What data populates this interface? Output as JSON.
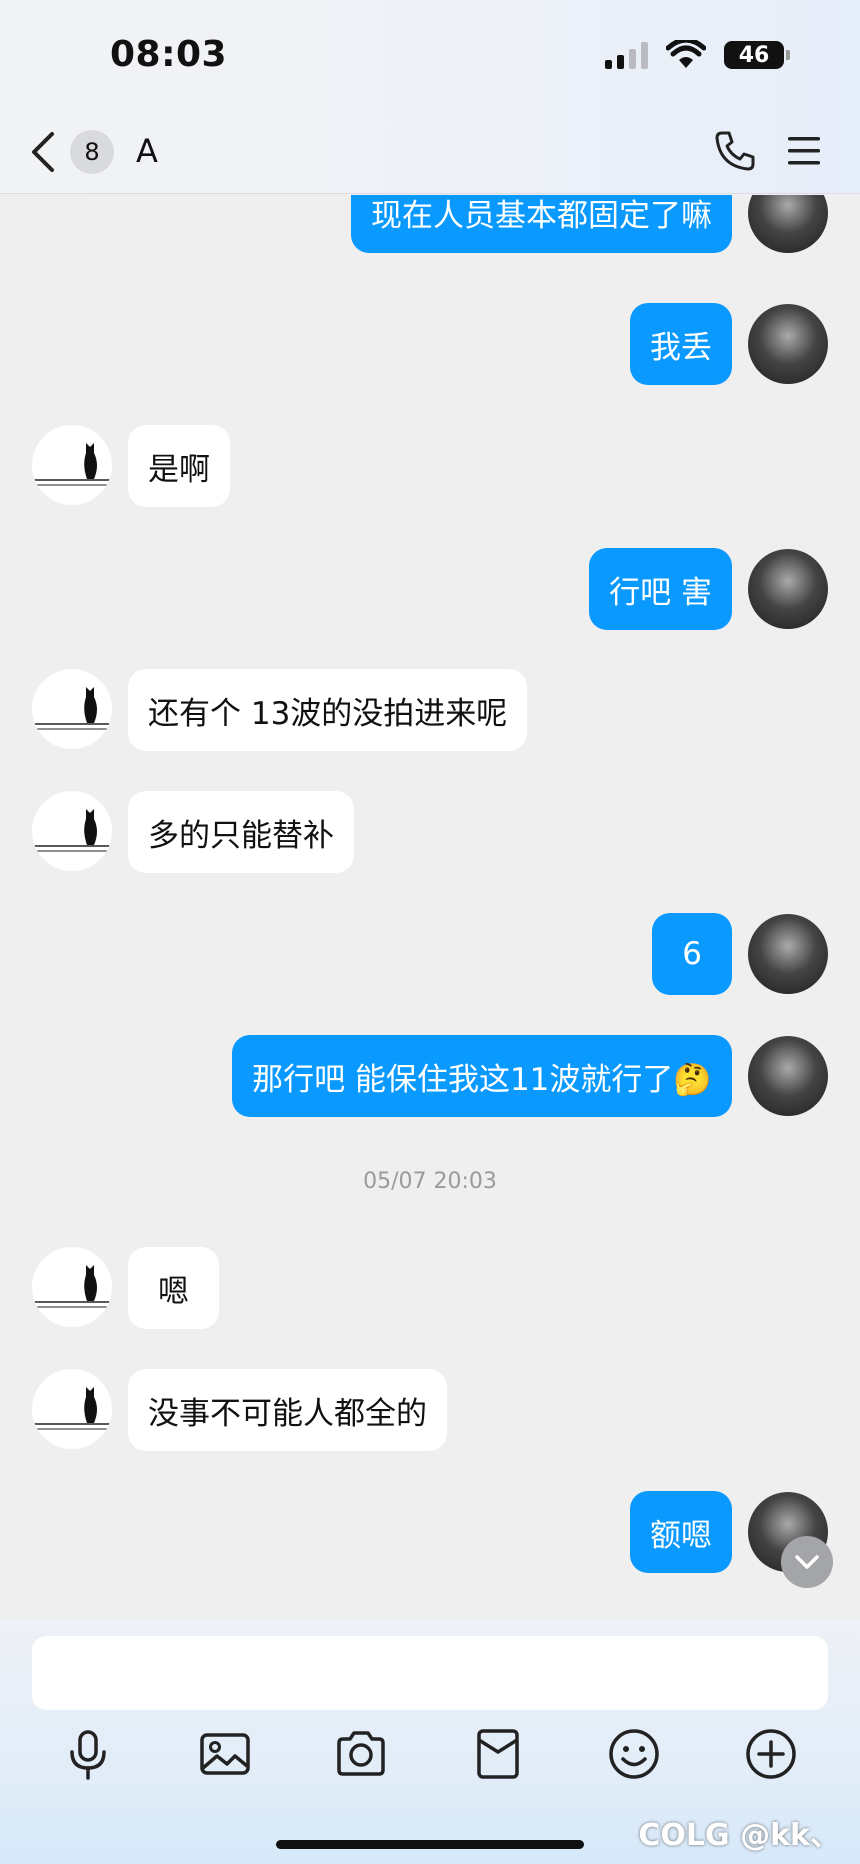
{
  "status_bar": {
    "time": "08:03",
    "battery": "46"
  },
  "header": {
    "unread_count": "8",
    "title": "A"
  },
  "messages": [
    {
      "from": "me",
      "text": "现在人员基本都固定了嘛"
    },
    {
      "from": "me",
      "text": "我丢"
    },
    {
      "from": "other",
      "text": "是啊"
    },
    {
      "from": "me",
      "text": "行吧 害"
    },
    {
      "from": "other",
      "text": "还有个 13波的没拍进来呢"
    },
    {
      "from": "other",
      "text": "多的只能替补"
    },
    {
      "from": "me",
      "text": "6"
    },
    {
      "from": "me",
      "text": "那行吧 能保住我这11波就行了🤔"
    },
    {
      "from": "system",
      "text": "05/07 20:03"
    },
    {
      "from": "other",
      "text": "嗯"
    },
    {
      "from": "other",
      "text": "没事不可能人都全的"
    },
    {
      "from": "me",
      "text": "额嗯"
    }
  ],
  "composer": {
    "placeholder": "",
    "tools": [
      "microphone-icon",
      "image-icon",
      "camera-icon",
      "red-packet-icon",
      "emoji-icon",
      "plus-icon"
    ]
  },
  "watermark": "COLG @kk、",
  "colors": {
    "accent": "#0a99ff",
    "background": "#efefef",
    "bubble_other": "#ffffff"
  }
}
